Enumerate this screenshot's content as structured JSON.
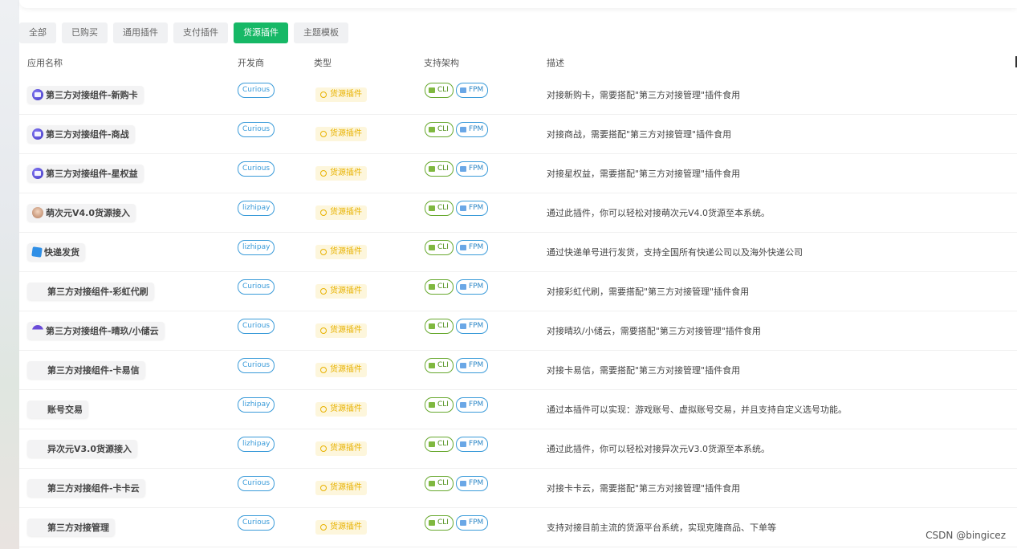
{
  "tabs": [
    {
      "label": "全部",
      "active": false
    },
    {
      "label": "已购买",
      "active": false
    },
    {
      "label": "通用插件",
      "active": false
    },
    {
      "label": "支付插件",
      "active": false
    },
    {
      "label": "货源插件",
      "active": true
    },
    {
      "label": "主题模板",
      "active": false
    }
  ],
  "columns": {
    "name": "应用名称",
    "developer": "开发商",
    "type": "类型",
    "arch": "支持架构",
    "desc": "描述"
  },
  "rows": [
    {
      "name": "第三方对接组件-新购卡",
      "icon": "purple-app-icon",
      "developer": "Curious",
      "type": "货源插件",
      "arch": [
        "CLI",
        "FPM"
      ],
      "desc": "对接新购卡，需要搭配\"第三方对接管理\"插件食用"
    },
    {
      "name": "第三方对接组件-商战",
      "icon": "purple-app-icon",
      "developer": "Curious",
      "type": "货源插件",
      "arch": [
        "CLI",
        "FPM"
      ],
      "desc": "对接商战，需要搭配\"第三方对接管理\"插件食用"
    },
    {
      "name": "第三方对接组件-星权益",
      "icon": "purple-app-icon",
      "developer": "Curious",
      "type": "货源插件",
      "arch": [
        "CLI",
        "FPM"
      ],
      "desc": "对接星权益，需要搭配\"第三方对接管理\"插件食用"
    },
    {
      "name": "萌次元V4.0货源接入",
      "icon": "avatar-icon",
      "developer": "lizhipay",
      "type": "货源插件",
      "arch": [
        "CLI",
        "FPM"
      ],
      "desc": "通过此插件，你可以轻松对接萌次元V4.0货源至本系统。"
    },
    {
      "name": "快递发货",
      "icon": "box-icon",
      "developer": "lizhipay",
      "type": "货源插件",
      "arch": [
        "CLI",
        "FPM"
      ],
      "desc": "通过快递单号进行发货，支持全国所有快递公司以及海外快递公司"
    },
    {
      "name": "第三方对接组件-彩虹代刷",
      "icon": "blank-icon",
      "developer": "Curious",
      "type": "货源插件",
      "arch": [
        "CLI",
        "FPM"
      ],
      "desc": "对接彩虹代刷，需要搭配\"第三方对接管理\"插件食用"
    },
    {
      "name": "第三方对接组件-晴玖/小储云",
      "icon": "half-icon",
      "developer": "Curious",
      "type": "货源插件",
      "arch": [
        "CLI",
        "FPM"
      ],
      "desc": "对接晴玖/小储云，需要搭配\"第三方对接管理\"插件食用"
    },
    {
      "name": "第三方对接组件-卡易信",
      "icon": "blank-icon",
      "developer": "Curious",
      "type": "货源插件",
      "arch": [
        "CLI",
        "FPM"
      ],
      "desc": "对接卡易信，需要搭配\"第三方对接管理\"插件食用"
    },
    {
      "name": "账号交易",
      "icon": "blank-icon",
      "developer": "lizhipay",
      "type": "货源插件",
      "arch": [
        "CLI",
        "FPM"
      ],
      "desc": "通过本插件可以实现：游戏账号、虚拟账号交易，并且支持自定义选号功能。"
    },
    {
      "name": "异次元V3.0货源接入",
      "icon": "blank-icon",
      "developer": "lizhipay",
      "type": "货源插件",
      "arch": [
        "CLI",
        "FPM"
      ],
      "desc": "通过此插件，你可以轻松对接异次元V3.0货源至本系统。"
    },
    {
      "name": "第三方对接组件-卡卡云",
      "icon": "blank-icon",
      "developer": "Curious",
      "type": "货源插件",
      "arch": [
        "CLI",
        "FPM"
      ],
      "desc": "对接卡卡云，需要搭配\"第三方对接管理\"插件食用"
    },
    {
      "name": "第三方对接管理",
      "icon": "blank-icon",
      "developer": "Curious",
      "type": "货源插件",
      "arch": [
        "CLI",
        "FPM"
      ],
      "desc": "支持对接目前主流的货源平台系统，实现克隆商品、下单等"
    }
  ],
  "watermark": "CSDN @bingicez",
  "colors": {
    "accent": "#16b866",
    "developer_badge": "#3a9bd9",
    "type_badge": "#e8b200",
    "cli_badge": "#67a82e"
  }
}
